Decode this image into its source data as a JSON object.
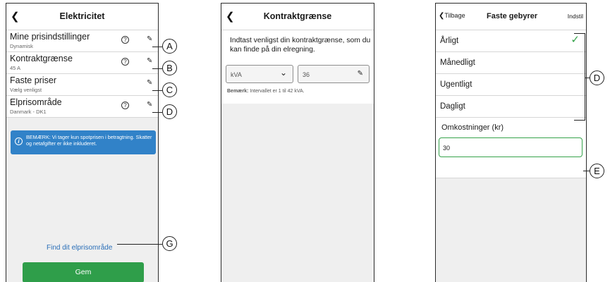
{
  "screen1": {
    "back_icon": "chevron-left-icon",
    "title": "Elektricitet",
    "rows": [
      {
        "title": "Mine prisindstillinger",
        "sub": "Dynamisk",
        "help": "?",
        "callout": "A"
      },
      {
        "title": "Kontraktgrænse",
        "sub": "45 A",
        "help": "?",
        "callout": "B"
      },
      {
        "title": "Faste priser",
        "sub": "Vælg venligst",
        "help": "",
        "callout": "C"
      },
      {
        "title": "Elprisområde",
        "sub": "Danmark - DK1",
        "help": "?",
        "callout": "D"
      }
    ],
    "note": "BEMÆRK: Vi tager kun spotprisen i betragtning. Skatter og netafgifter er ikke inkluderet.",
    "link": "Find dit elprisområde",
    "link_callout": "G",
    "save_label": "Gem",
    "accent": "#3182c8",
    "button_color": "#2f9e4a"
  },
  "screen2": {
    "title": "Kontraktgrænse",
    "instruction": "Indtast venligst din kontraktgrænse, som du kan finde på din elregning.",
    "unit": "kVA",
    "value": "36",
    "note_bold": "Bemærk:",
    "note_text": " Intervallet er 1 til 42 kVA."
  },
  "screen3": {
    "back_label": "Tilbage",
    "title": "Faste gebyrer",
    "action": "Indstil",
    "options": [
      "Årligt",
      "Månedligt",
      "Ugentligt",
      "Dagligt"
    ],
    "selected": "Årligt",
    "options_callout": "D",
    "cost_label": "Omkostninger (kr)",
    "cost_value": "30",
    "cost_callout": "E",
    "check_color": "#36a34b"
  }
}
